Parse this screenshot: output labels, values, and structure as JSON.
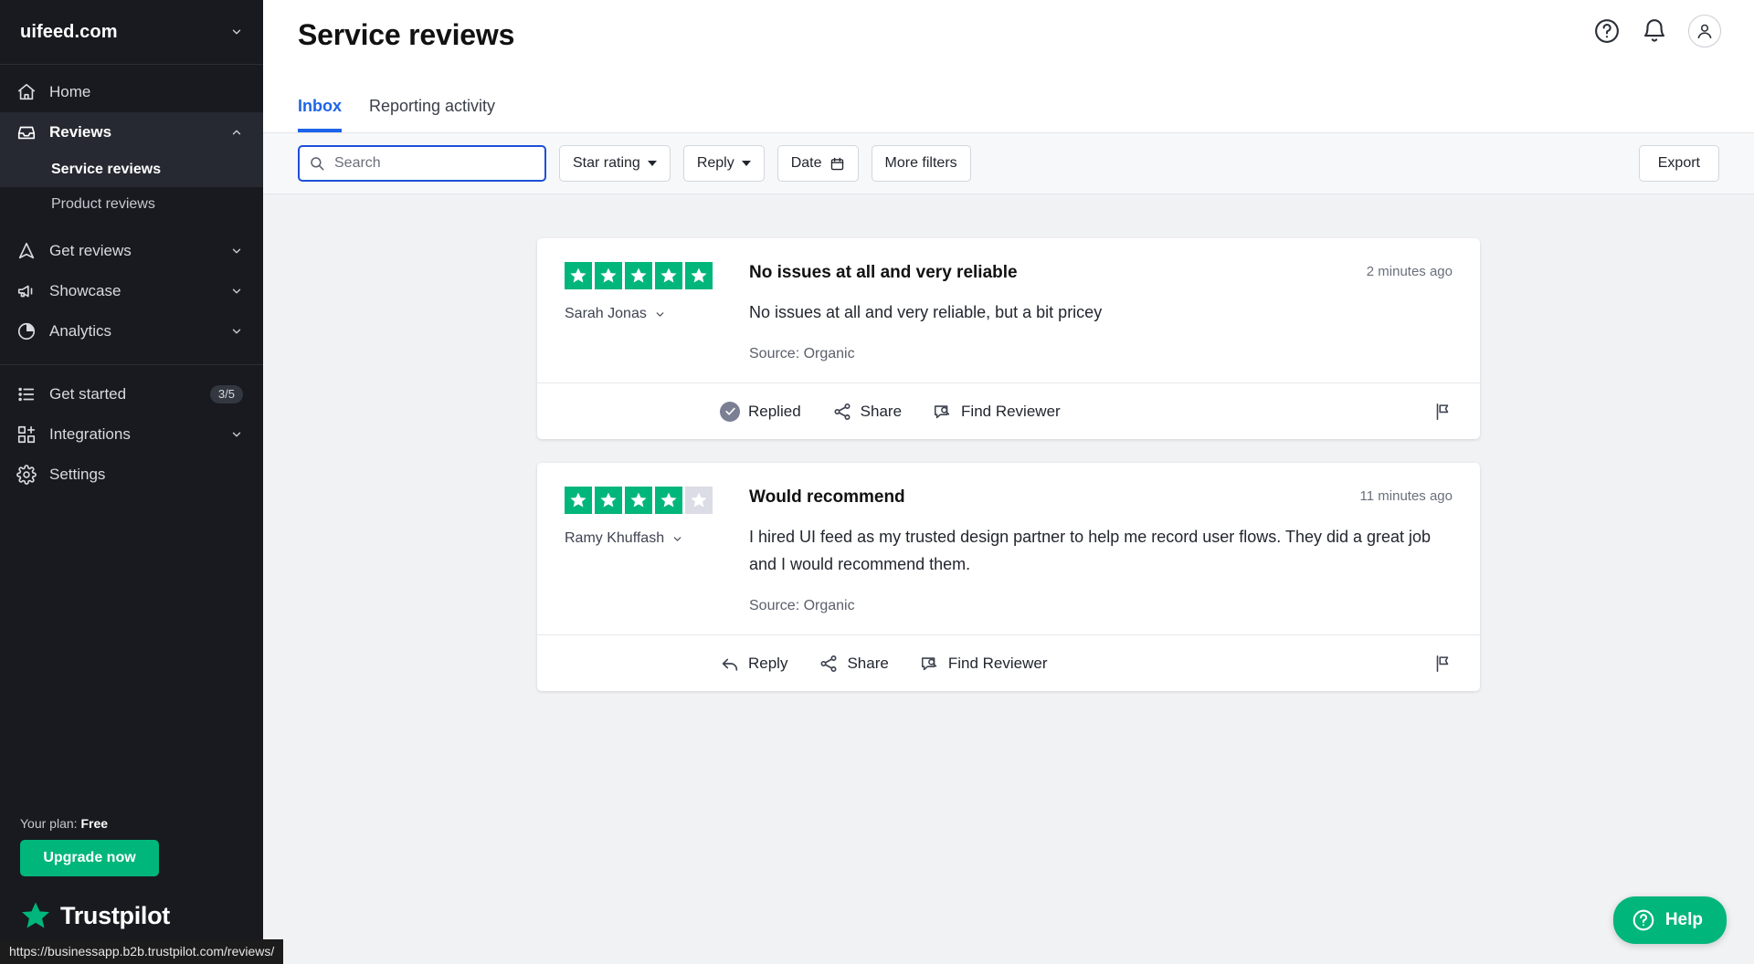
{
  "sidebar": {
    "brand": "uifeed.com",
    "brand_chevron": "chevron-down",
    "nav": [
      {
        "label": "Home",
        "icon": "home-icon"
      },
      {
        "label": "Reviews",
        "icon": "inbox-icon"
      },
      {
        "label": "Get reviews",
        "icon": "send-icon"
      },
      {
        "label": "Showcase",
        "icon": "megaphone-icon"
      },
      {
        "label": "Analytics",
        "icon": "pie-chart-icon"
      }
    ],
    "sub_items": [
      {
        "label": "Service reviews"
      },
      {
        "label": "Product reviews"
      }
    ],
    "secondary": [
      {
        "label": "Get started",
        "icon": "list-icon",
        "badge": "3/5"
      },
      {
        "label": "Integrations",
        "icon": "grid-plus-icon"
      },
      {
        "label": "Settings",
        "icon": "gear-icon"
      }
    ],
    "plan_prefix": "Your plan: ",
    "plan_value": "Free",
    "upgrade_label": "Upgrade now",
    "logo_text": "Trustpilot"
  },
  "status_bar": {
    "url": "https://businessapp.b2b.trustpilot.com/reviews/"
  },
  "header": {
    "title": "Service reviews",
    "icons": [
      "help-circle-icon",
      "bell-icon",
      "user-avatar-icon"
    ]
  },
  "tabs": [
    {
      "label": "Inbox",
      "active": true
    },
    {
      "label": "Reporting activity",
      "active": false
    }
  ],
  "filters": {
    "search_placeholder": "Search",
    "search_value": "",
    "buttons": [
      {
        "label": "Star rating",
        "type": "dropdown"
      },
      {
        "label": "Reply",
        "type": "dropdown"
      },
      {
        "label": "Date",
        "type": "calendar"
      },
      {
        "label": "More filters",
        "type": "plain"
      }
    ],
    "export_label": "Export"
  },
  "reviews": [
    {
      "rating": 5,
      "max_rating": 5,
      "author": "Sarah Jonas",
      "title": "No issues at all and very reliable",
      "time": "2 minutes ago",
      "text": "No issues at all and very reliable, but a bit pricey",
      "source_label": "Source: Organic",
      "actions": [
        {
          "label": "Replied",
          "icon": "check-circle-filled-icon"
        },
        {
          "label": "Share",
          "icon": "share-icon"
        },
        {
          "label": "Find Reviewer",
          "icon": "find-reviewer-icon"
        }
      ],
      "flag_icon": "flag-icon"
    },
    {
      "rating": 4,
      "max_rating": 5,
      "author": "Ramy Khuffash",
      "title": "Would recommend",
      "time": "11 minutes ago",
      "text": "I hired UI feed as my trusted design partner to help me record user flows. They did a great job and I would recommend them.",
      "source_label": "Source: Organic",
      "actions": [
        {
          "label": "Reply",
          "icon": "reply-arrow-icon"
        },
        {
          "label": "Share",
          "icon": "share-icon"
        },
        {
          "label": "Find Reviewer",
          "icon": "find-reviewer-icon"
        }
      ],
      "flag_icon": "flag-icon"
    }
  ],
  "help_fab": {
    "label": "Help",
    "icon": "question-circle-icon"
  },
  "colors": {
    "brand_green": "#00b67a",
    "accent_blue": "#1d64e8",
    "sidebar_bg": "#181a20",
    "star_off": "#dcdce6"
  }
}
